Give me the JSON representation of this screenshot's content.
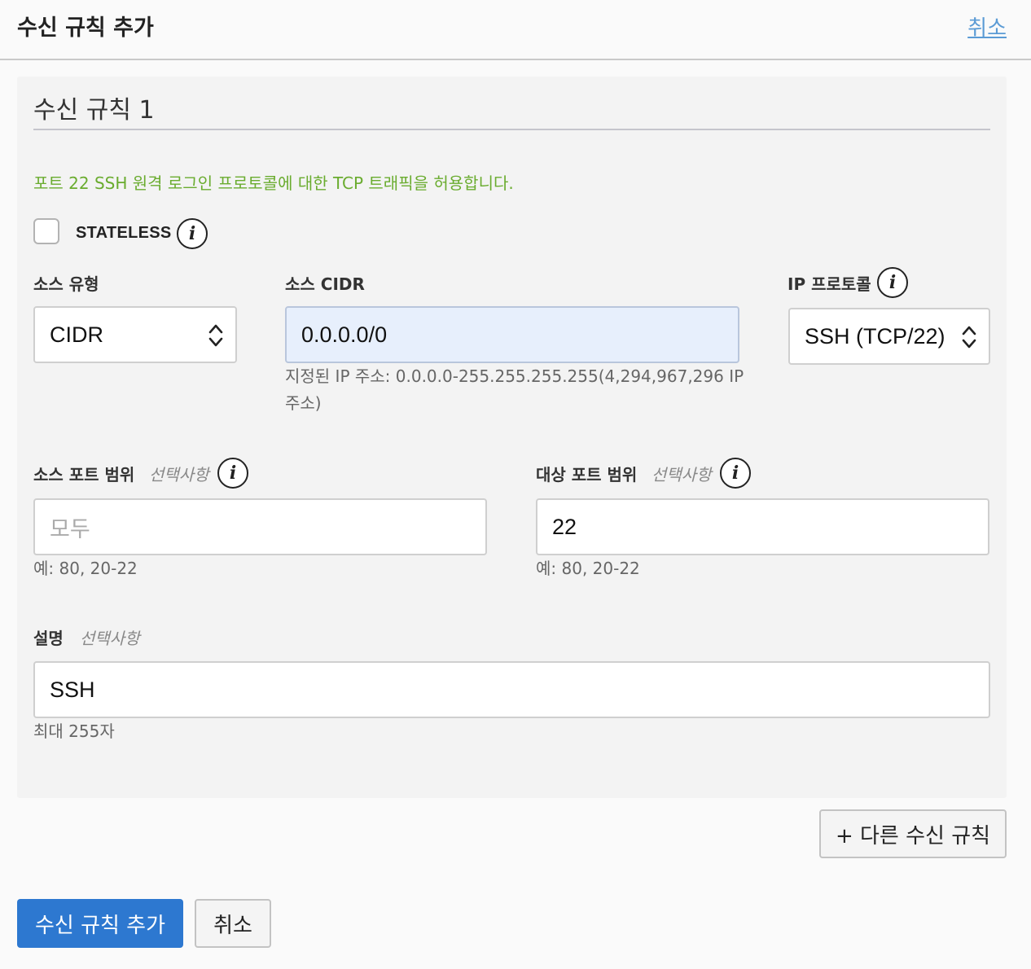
{
  "header": {
    "title": "수신 규칙 추가",
    "cancel_link": "취소"
  },
  "rule": {
    "title": "수신 규칙 1",
    "note": "포트 22 SSH 원격 로그인 프로토콜에 대한 TCP 트래픽을 허용합니다.",
    "stateless": {
      "label": "STATELESS",
      "checked": false
    },
    "source_type": {
      "label": "소스 유형",
      "value": "CIDR"
    },
    "source_cidr": {
      "label": "소스 CIDR",
      "value": "0.0.0.0/0",
      "help_line1": "지정된 IP 주소: 0.0.0.0-255.255.255.255(4,294,967,296 IP",
      "help_line2": "주소)"
    },
    "ip_protocol": {
      "label": "IP 프로토콜",
      "value": "SSH (TCP/22)"
    },
    "source_port": {
      "label": "소스 포트 범위",
      "optional": "선택사항",
      "placeholder": "모두",
      "help": "예: 80, 20-22"
    },
    "dest_port": {
      "label": "대상 포트 범위",
      "optional": "선택사항",
      "value": "22",
      "help": "예: 80, 20-22"
    },
    "description": {
      "label": "설명",
      "optional": "선택사항",
      "value": "SSH",
      "help": "최대 255자"
    }
  },
  "buttons": {
    "add_another": "+ 다른 수신 규칙",
    "submit": "수신 규칙 추가",
    "cancel": "취소"
  },
  "icons": {
    "info": "info-icon",
    "chevron": "chevron-up-down-icon"
  },
  "colors": {
    "primary": "#2d78d0",
    "note_green": "#6aac2f",
    "link_blue": "#5b9bd5",
    "focused_input": "#e7effc"
  }
}
